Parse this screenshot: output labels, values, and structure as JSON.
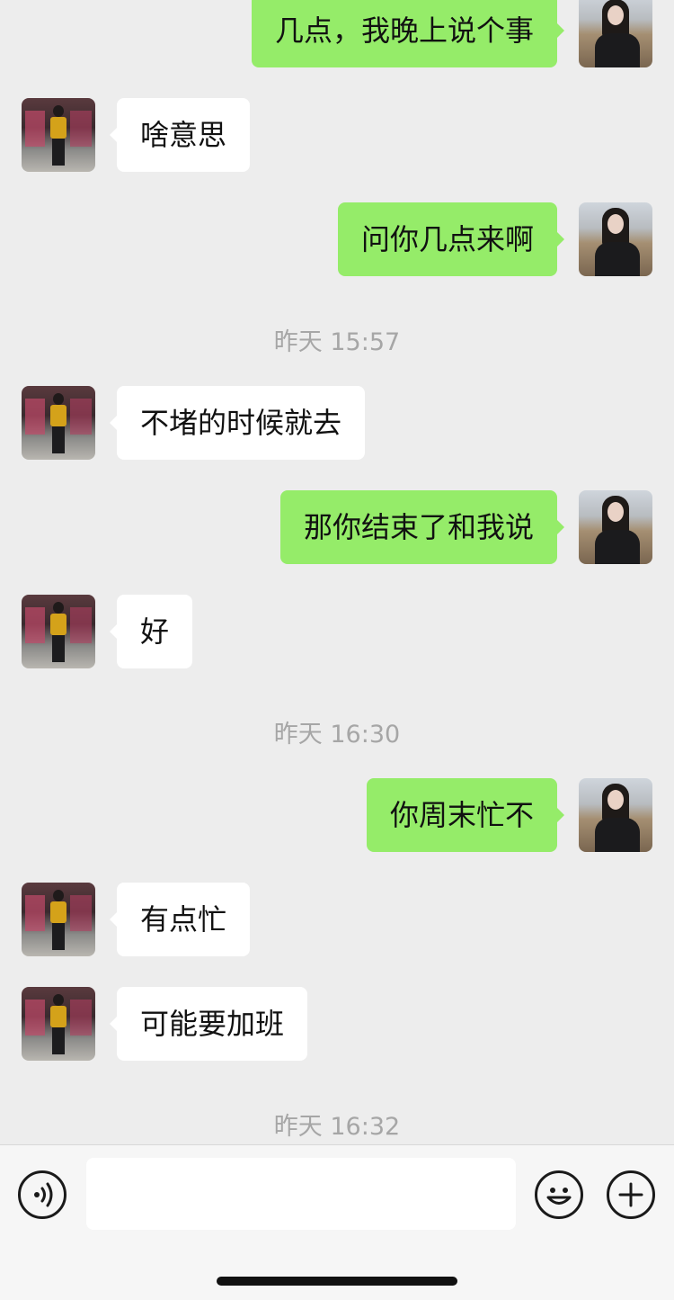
{
  "messages": [
    {
      "side": "right",
      "text": "几点，我晚上说个事"
    },
    {
      "side": "left",
      "text": "啥意思"
    },
    {
      "side": "right",
      "text": "问你几点来啊"
    },
    {
      "time": "昨天 15:57"
    },
    {
      "side": "left",
      "text": "不堵的时候就去"
    },
    {
      "side": "right",
      "text": "那你结束了和我说"
    },
    {
      "side": "left",
      "text": "好"
    },
    {
      "time": "昨天 16:30"
    },
    {
      "side": "right",
      "text": "你周末忙不"
    },
    {
      "side": "left",
      "text": "有点忙"
    },
    {
      "side": "left",
      "text": "可能要加班"
    },
    {
      "time": "昨天 16:32"
    }
  ],
  "input_bar": {
    "icons": {
      "voice": "voice-icon",
      "emoji": "emoji-icon",
      "more": "plus-icon"
    },
    "input_value": ""
  },
  "colors": {
    "background": "#ededed",
    "sent_bubble": "#95ec69",
    "received_bubble": "#ffffff",
    "timestamp": "#a6a6a6"
  }
}
